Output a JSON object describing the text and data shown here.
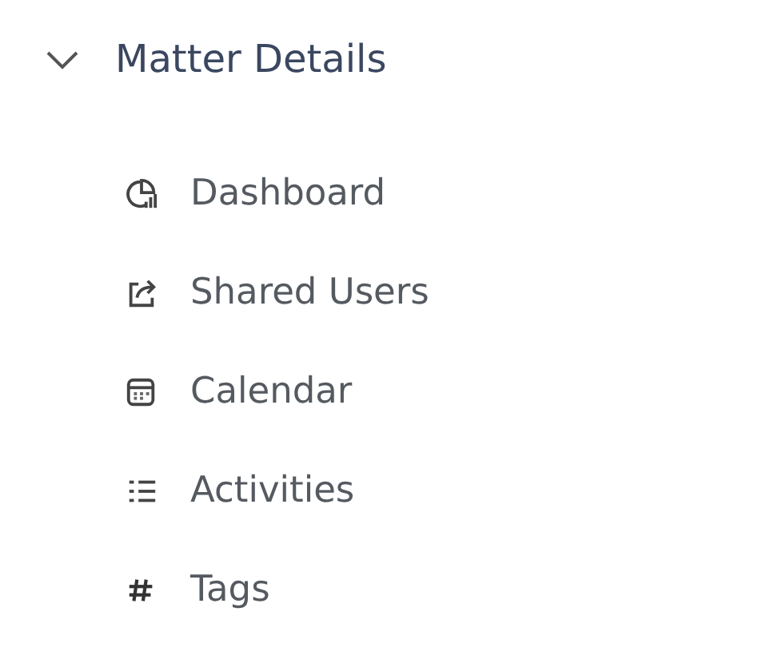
{
  "section": {
    "title": "Matter Details",
    "expanded": true,
    "items": [
      {
        "label": "Dashboard",
        "kind": "dashboard"
      },
      {
        "label": "Shared Users",
        "kind": "share"
      },
      {
        "label": "Calendar",
        "kind": "calendar"
      },
      {
        "label": "Activities",
        "kind": "list"
      },
      {
        "label": "Tags",
        "kind": "hash"
      }
    ]
  }
}
